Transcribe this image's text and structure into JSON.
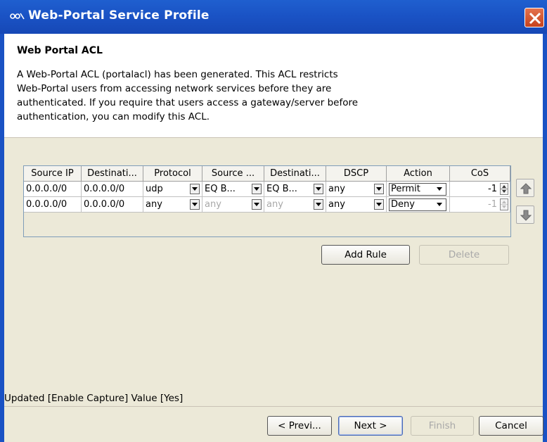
{
  "window": {
    "title": "Web-Portal Service Profile"
  },
  "header": {
    "heading": "Web Portal ACL",
    "description_lines": [
      "A Web-Portal ACL (portalacl) has been generated. This ACL restricts",
      "Web-Portal users from accessing network services before they are",
      "authenticated. If you require that users access a gateway/server before",
      "authentication, you can modify this ACL."
    ]
  },
  "table": {
    "columns": [
      "Source IP",
      "Destinati...",
      "Protocol",
      "Source ...",
      "Destinati...",
      "DSCP",
      "Action",
      "CoS"
    ],
    "rows": [
      {
        "source_ip": "0.0.0.0/0",
        "destination": "0.0.0.0/0",
        "protocol": "udp",
        "source_port": "EQ B...",
        "dest_port": "EQ B...",
        "dscp": "any",
        "action": "Permit",
        "cos": "-1"
      },
      {
        "source_ip": "0.0.0.0/0",
        "destination": "0.0.0.0/0",
        "protocol": "any",
        "source_port": "any",
        "dest_port": "any",
        "dscp": "any",
        "action": "Deny",
        "cos": "-1"
      }
    ]
  },
  "buttons": {
    "add_rule": "Add Rule",
    "delete": "Delete",
    "previous": "< Previ...",
    "next": "Next >",
    "finish": "Finish",
    "cancel": "Cancel"
  },
  "status": "Updated [Enable Capture] Value [Yes]",
  "colors": {
    "titlebar": "#1a52c4",
    "panel": "#ece9d8",
    "close": "#d4532e"
  },
  "icons": {
    "app": "dialog-app-icon",
    "close": "close-icon",
    "up": "move-up-icon",
    "down": "move-down-icon"
  }
}
